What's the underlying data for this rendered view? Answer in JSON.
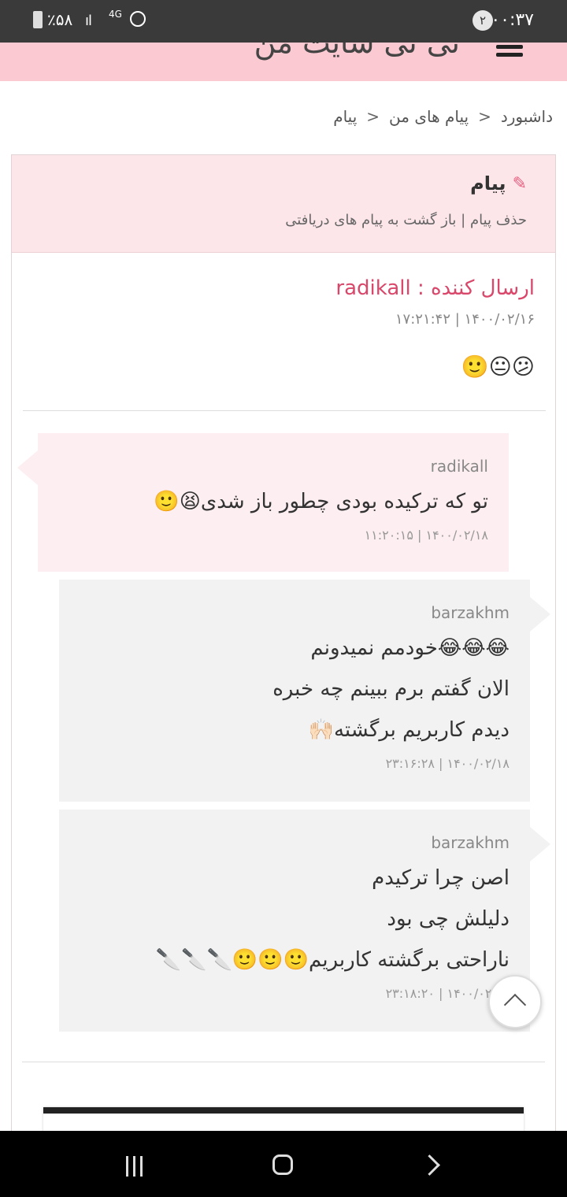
{
  "status_bar": {
    "time": "۰۰:۳۷",
    "notifications": "۲",
    "battery": "٪۵۸",
    "network": "4G"
  },
  "header": {
    "site_title": "تی تی سایت من"
  },
  "breadcrumb": [
    "داشبورد",
    "پیام های من",
    "پیام"
  ],
  "panel": {
    "title": "پیام",
    "delete_link": "حذف پیام",
    "back_link": "باز گشت به پیام های دریافتی"
  },
  "message": {
    "sender_label": "ارسال کننده : radikall",
    "datetime": "۱۷:۲۱:۴۲ | ۱۴۰۰/۰۲/۱۶",
    "body": "😕😐🙂"
  },
  "thread": [
    {
      "side": "in",
      "author": "radikall",
      "lines": [
        "تو که ترکیده بودی چطور باز شدی😫🙂"
      ],
      "stamp": "۱۱:۲۰:۱۵ | ۱۴۰۰/۰۲/۱۸"
    },
    {
      "side": "out",
      "author": "barzakhm",
      "lines": [
        "😂😂😂خودمم نمیدونم",
        "الان گفتم برم ببینم چه خبره",
        "دیدم کاربریم برگشته🙌🏻"
      ],
      "stamp": "۲۳:۱۶:۲۸ | ۱۴۰۰/۰۲/۱۸"
    },
    {
      "side": "out",
      "author": "barzakhm",
      "lines": [
        "اصن چرا ترکیدم",
        "دلیلش چی بود",
        "ناراحتی برگشته کاربریم🙂🙂🙂🔪🔪🔪"
      ],
      "stamp": "۲۳:۱۸:۲۰ | ۱۴۰۰/۰۲/۱۸"
    }
  ]
}
